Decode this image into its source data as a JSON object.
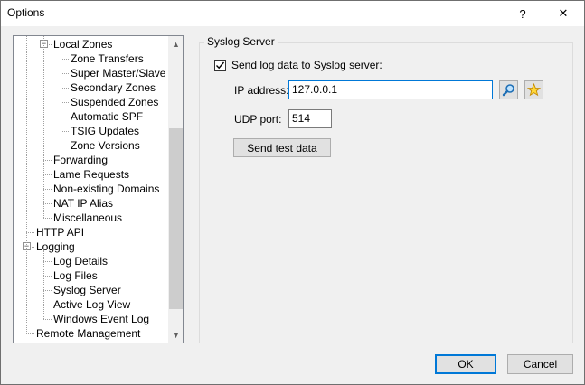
{
  "window": {
    "title": "Options",
    "help_glyph": "?",
    "close_glyph": "✕"
  },
  "tree": {
    "items": [
      {
        "label": "Local Zones",
        "level": 1,
        "expander": "-"
      },
      {
        "label": "Zone Transfers",
        "level": 2
      },
      {
        "label": "Super Master/Slave",
        "level": 2
      },
      {
        "label": "Secondary Zones",
        "level": 2
      },
      {
        "label": "Suspended Zones",
        "level": 2
      },
      {
        "label": "Automatic SPF",
        "level": 2
      },
      {
        "label": "TSIG Updates",
        "level": 2
      },
      {
        "label": "Zone Versions",
        "level": 2
      },
      {
        "label": "Forwarding",
        "level": 1
      },
      {
        "label": "Lame Requests",
        "level": 1
      },
      {
        "label": "Non-existing Domains",
        "level": 1
      },
      {
        "label": "NAT IP Alias",
        "level": 1
      },
      {
        "label": "Miscellaneous",
        "level": 1
      },
      {
        "label": "HTTP API",
        "level": 0
      },
      {
        "label": "Logging",
        "level": 0,
        "expander": "-"
      },
      {
        "label": "Log Details",
        "level": 1
      },
      {
        "label": "Log Files",
        "level": 1
      },
      {
        "label": "Syslog Server",
        "level": 1,
        "selected": true
      },
      {
        "label": "Active Log View",
        "level": 1
      },
      {
        "label": "Windows Event Log",
        "level": 1
      },
      {
        "label": "Remote Management",
        "level": 0
      }
    ],
    "scroll_up_glyph": "▲",
    "scroll_down_glyph": "▼"
  },
  "syslog": {
    "group_title": "Syslog Server",
    "send_checkbox_label": "Send log data to Syslog server:",
    "send_checked": true,
    "ip_label": "IP address:",
    "ip_value": "127.0.0.1",
    "udp_label": "UDP port:",
    "udp_value": "514",
    "test_button": "Send test data"
  },
  "footer": {
    "ok_label": "OK",
    "cancel_label": "Cancel"
  },
  "icons": {
    "lookup": "magnifier-icon",
    "favorites": "star-icon"
  }
}
